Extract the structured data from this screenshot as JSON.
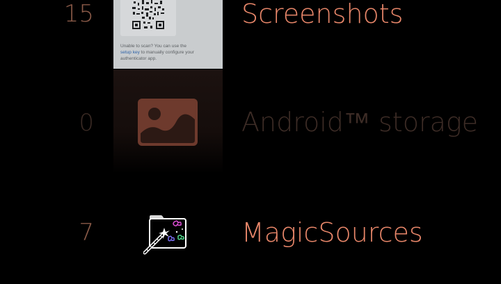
{
  "folders": [
    {
      "count": "15",
      "name": "Screenshots",
      "icon": "screenshot-thumbnail"
    },
    {
      "count": "0",
      "name": "Android™ storage",
      "icon": "image-placeholder-icon"
    },
    {
      "count": "7",
      "name": "MagicSources",
      "icon": "magic-folder-icon"
    }
  ],
  "screenshot_preview": {
    "line1": "Unable to scan? You can use the",
    "link": "setup key",
    "line2": "to manually configure your",
    "line3": "authenticator app."
  },
  "colors": {
    "accent": "#e9876a",
    "count_active": "#8a5a48",
    "dimmed": "#3d2c26",
    "background": "#000000"
  }
}
